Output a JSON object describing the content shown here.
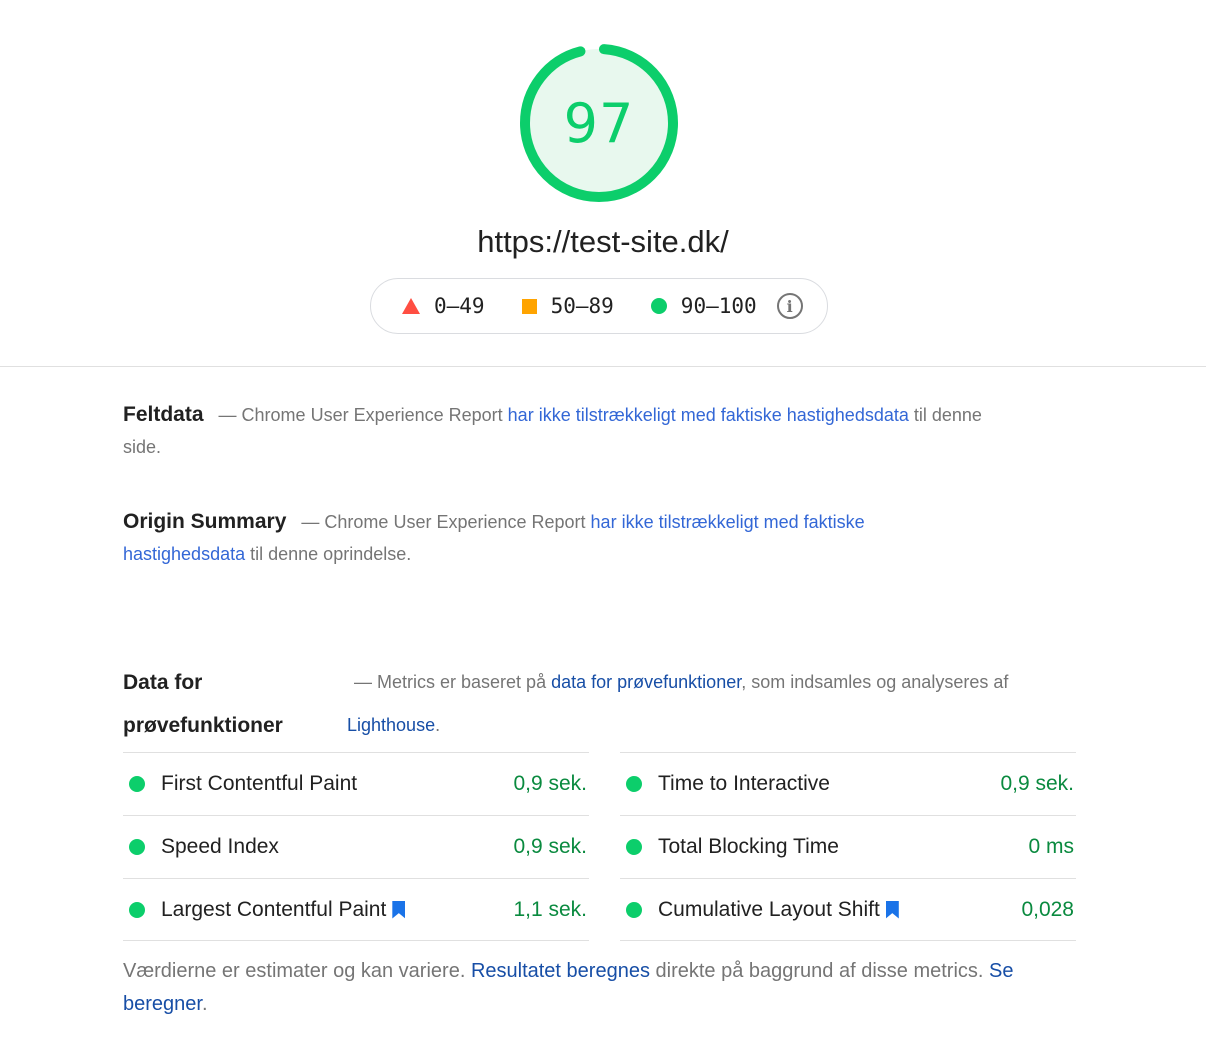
{
  "score": {
    "value": "97",
    "fraction": 0.97,
    "color": "#0cce6b"
  },
  "url": "https://test-site.dk/",
  "legend": {
    "items": [
      {
        "icon": "triangle-red-icon",
        "label": "0–49",
        "color": "#ff4e42"
      },
      {
        "icon": "square-orange-icon",
        "label": "50–89",
        "color": "#ffa400"
      },
      {
        "icon": "circle-green-icon",
        "label": "90–100",
        "color": "#0cce6b"
      }
    ],
    "info_icon": "info-icon"
  },
  "field_data": {
    "title": "Feltdata",
    "dash": "—",
    "prefix": "Chrome User Experience Report",
    "link": "har ikke tilstrækkeligt med faktiske hastighedsdata",
    "suffix": "til denne side."
  },
  "origin_summary": {
    "title": "Origin Summary",
    "dash": "—",
    "prefix": "Chrome User Experience Report",
    "link": "har ikke tilstrækkeligt med faktiske hastighedsdata",
    "suffix": "til denne oprindelse."
  },
  "lab_data": {
    "title_line1": "Data for",
    "title_line2": "prøvefunktioner",
    "dash": "—",
    "prefix": "Metrics er baseret på",
    "link": "data for prøvefunktioner",
    "middle": ", som indsamles og analyseres af",
    "link2": "Lighthouse",
    "end": "."
  },
  "metrics": {
    "left": [
      {
        "name": "First Contentful Paint",
        "value": "0,9 sek.",
        "bookmark": false
      },
      {
        "name": "Speed Index",
        "value": "0,9 sek.",
        "bookmark": false
      },
      {
        "name": "Largest Contentful Paint",
        "value": "1,1 sek.",
        "bookmark": true
      }
    ],
    "right": [
      {
        "name": "Time to Interactive",
        "value": "0,9 sek.",
        "bookmark": false
      },
      {
        "name": "Total Blocking Time",
        "value": "0 ms",
        "bookmark": false
      },
      {
        "name": "Cumulative Layout Shift",
        "value": "0,028",
        "bookmark": true
      }
    ]
  },
  "footer": {
    "text1": "Værdierne er estimater og kan variere.",
    "link1": "Resultatet beregnes",
    "text2": "direkte på baggrund af disse metrics.",
    "link2": "Se beregner",
    "end": "."
  }
}
